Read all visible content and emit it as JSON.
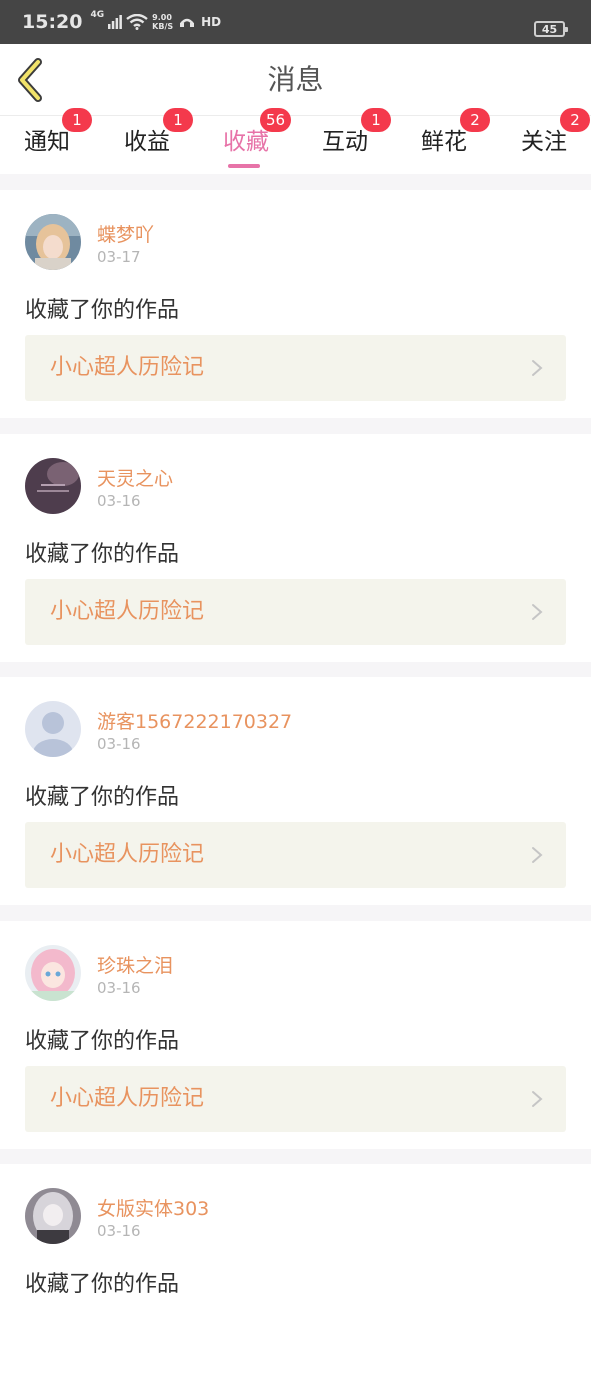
{
  "status_bar": {
    "time": "15:20",
    "network": "4G",
    "speed_value": "9.00",
    "speed_unit": "KB/S",
    "hd": "HD",
    "battery": "45"
  },
  "header": {
    "title": "消息"
  },
  "tabs": [
    {
      "label": "通知",
      "badge": "1",
      "active": false
    },
    {
      "label": "收益",
      "badge": "1",
      "active": false
    },
    {
      "label": "收藏",
      "badge": "56",
      "active": true
    },
    {
      "label": "互动",
      "badge": "1",
      "active": false
    },
    {
      "label": "鲜花",
      "badge": "2",
      "active": false
    },
    {
      "label": "关注",
      "badge": "2",
      "active": false
    }
  ],
  "colors": {
    "accent_pink": "#e773a8",
    "username_orange": "#e8935f",
    "badge_red": "#f4394c",
    "work_bg": "#f4f4ec"
  },
  "items": [
    {
      "username": "蝶梦吖",
      "date": "03-17",
      "action": "收藏了你的作品",
      "work_title": "小心超人历险记",
      "avatar": "avatar-girl-photo"
    },
    {
      "username": "天灵之心",
      "date": "03-16",
      "action": "收藏了你的作品",
      "work_title": "小心超人历险记",
      "avatar": "avatar-dark-sky"
    },
    {
      "username": "游客1567222170327",
      "date": "03-16",
      "action": "收藏了你的作品",
      "work_title": "小心超人历险记",
      "avatar": "avatar-default-user"
    },
    {
      "username": "珍珠之泪",
      "date": "03-16",
      "action": "收藏了你的作品",
      "work_title": "小心超人历险记",
      "avatar": "avatar-anime-pink"
    },
    {
      "username": "女版实体303",
      "date": "03-16",
      "action": "收藏了你的作品",
      "work_title": "",
      "avatar": "avatar-anime-gray"
    }
  ]
}
